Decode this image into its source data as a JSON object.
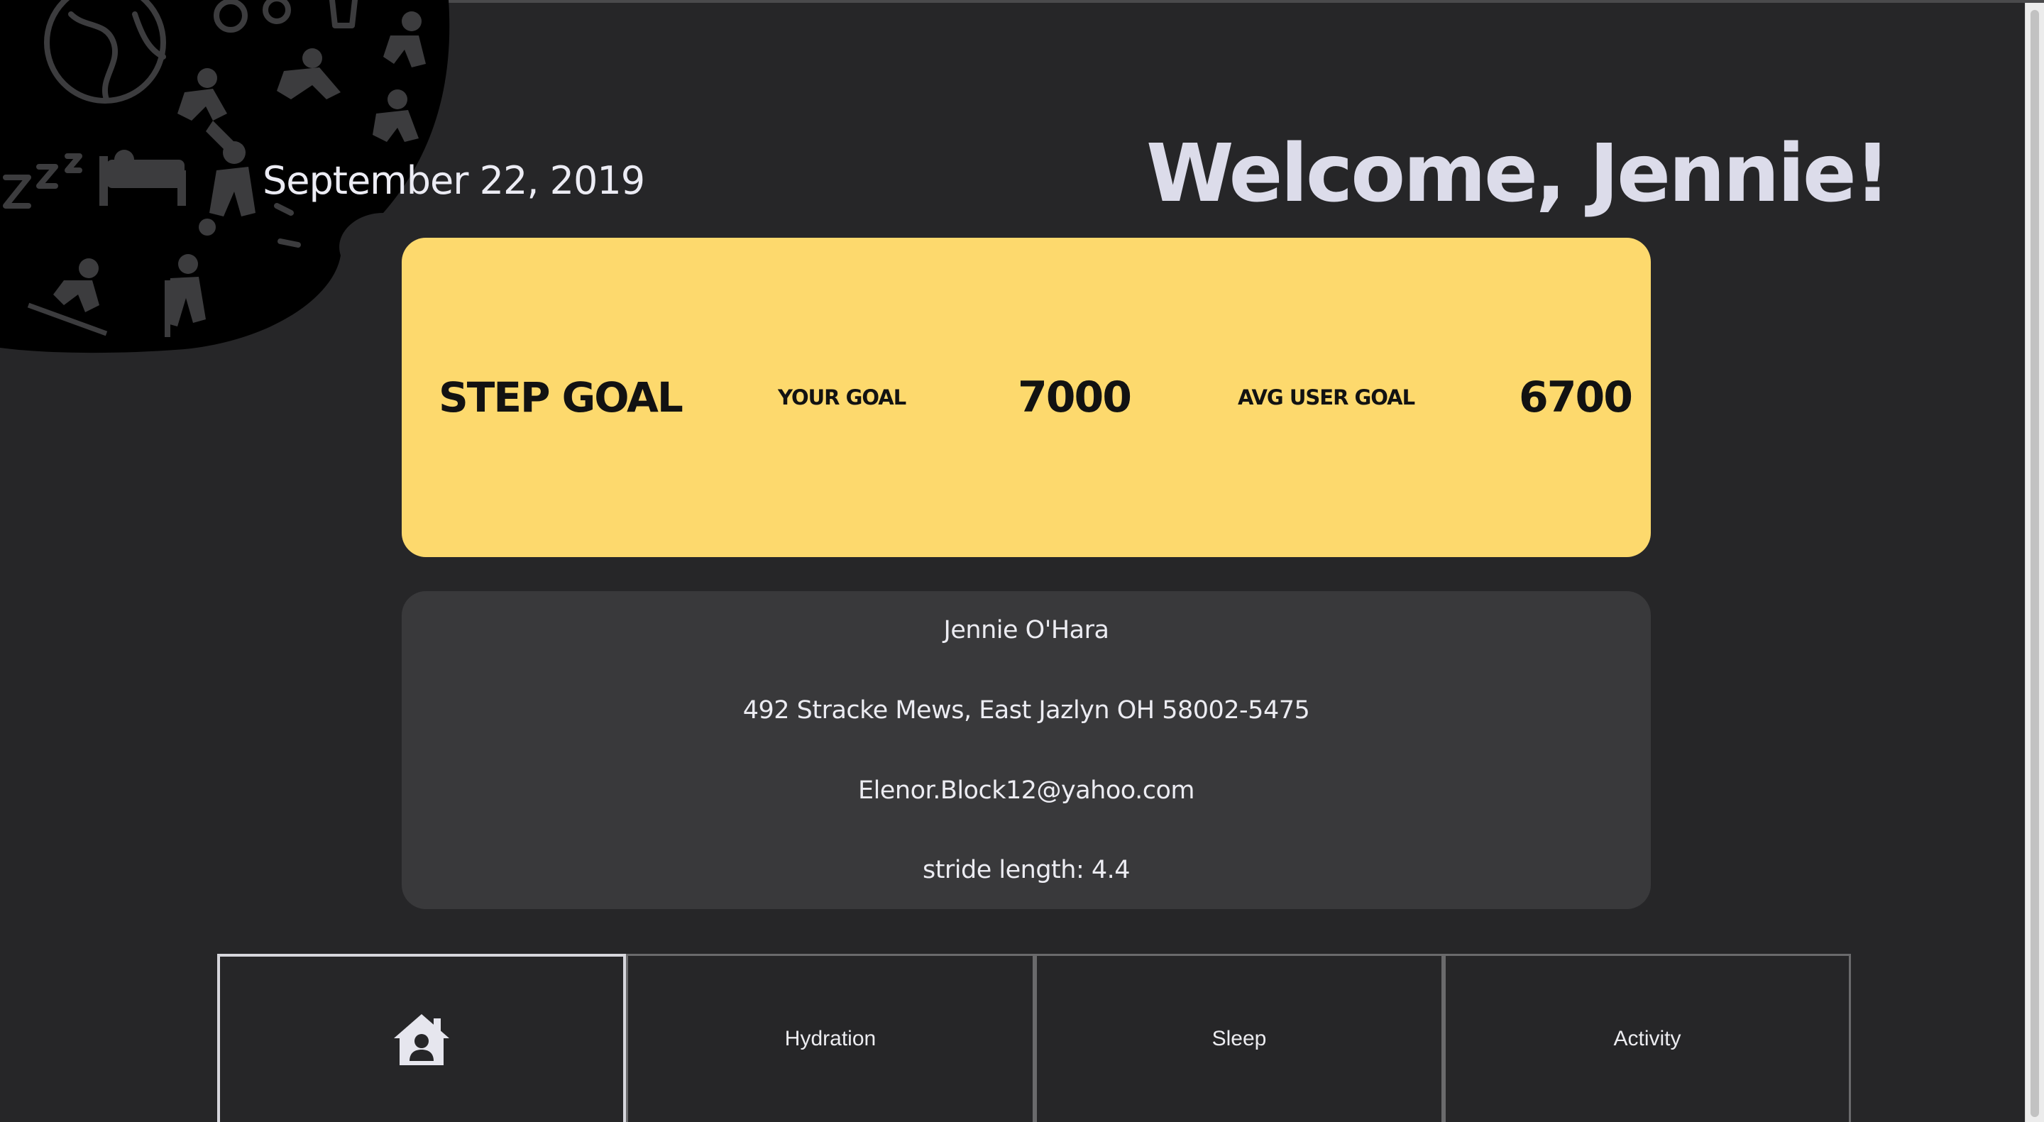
{
  "header": {
    "date": "September 22, 2019",
    "welcome": "Welcome, Jennie!"
  },
  "step_goal": {
    "title": "STEP GOAL",
    "your_goal_label": "YOUR GOAL",
    "your_goal_value": "7000",
    "avg_goal_label": "AVG USER GOAL",
    "avg_goal_value": "6700"
  },
  "user_info": {
    "name": "Jennie O'Hara",
    "address": "492 Stracke Mews, East Jazlyn OH 58002-5475",
    "email": "Elenor.Block12@yahoo.com",
    "stride": "stride length: 4.4"
  },
  "nav": {
    "home_icon": "home-user-icon",
    "hydration": "Hydration",
    "sleep": "Sleep",
    "activity": "Activity"
  },
  "colors": {
    "background": "#262628",
    "step_card": "#fdd96d",
    "info_card": "#39393b",
    "title_text": "#dcdcea"
  }
}
